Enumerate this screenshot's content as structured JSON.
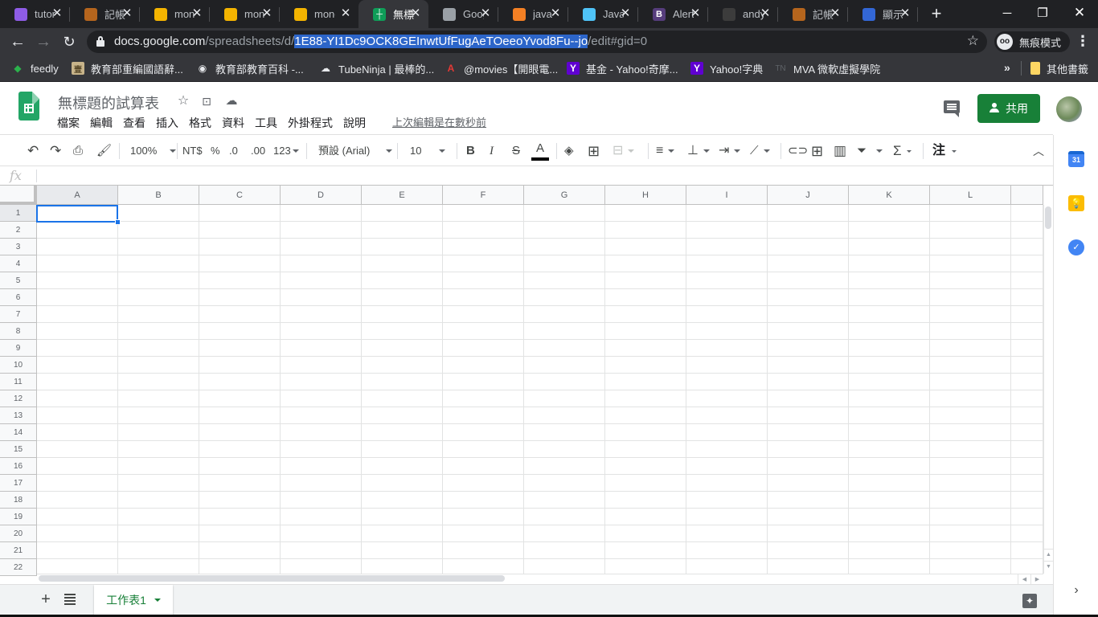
{
  "browser": {
    "tabs": [
      {
        "title": "tutorial",
        "icon": "stack-icon",
        "color": "#8e5ce6"
      },
      {
        "title": "記帳",
        "icon": "book-icon",
        "color": "#b5651d"
      },
      {
        "title": "money",
        "icon": "apps-script-icon",
        "color": "#f4b400"
      },
      {
        "title": "money",
        "icon": "apps-script-icon",
        "color": "#f4b400"
      },
      {
        "title": "money",
        "icon": "apps-script-icon",
        "color": "#f4b400"
      },
      {
        "title": "無標題的試算表",
        "icon": "sheets-icon",
        "color": "#0f9d58",
        "active": true
      },
      {
        "title": "Google",
        "icon": "circle-icon",
        "color": "#9aa0a6"
      },
      {
        "title": "java",
        "icon": "stackoverflow-icon",
        "color": "#f48024"
      },
      {
        "title": "Java",
        "icon": "globe-icon",
        "color": "#4fc3f7"
      },
      {
        "title": "Alert",
        "icon": "bootstrap-icon",
        "color": "#563d7c"
      },
      {
        "title": "andy",
        "icon": "github-icon",
        "color": "#3c3c3c"
      },
      {
        "title": "記帳",
        "icon": "book-icon",
        "color": "#b5651d"
      },
      {
        "title": "顯示",
        "icon": "chat-icon",
        "color": "#3367d6"
      }
    ],
    "new_tab": "+",
    "window_controls": {
      "minimize": "─",
      "restore": "❐",
      "close": "✕"
    },
    "url": {
      "host": "docs.google.com",
      "path_before": "/spreadsheets/d/",
      "selected": "1E88-YI1Dc9OCK8GEInwtUfFugAeTOeeoYvod8Fu--jo",
      "path_after": "/edit#gid=0"
    },
    "incognito_label": "無痕模式",
    "bookmarks": [
      {
        "label": "feedly",
        "icon": "feedly-icon",
        "color": "#2bb24c"
      },
      {
        "label": "教育部重編國語辭...",
        "icon": "dictionary-icon",
        "color": "#c8b48a"
      },
      {
        "label": "教育部教育百科 -...",
        "icon": "globe-icon",
        "color": "#e8eaed"
      },
      {
        "label": "TubeNinja | 最棒的...",
        "icon": "cloud-download-icon",
        "color": "#e8eaed"
      },
      {
        "label": "@movies【開眼電...",
        "icon": "atmovies-icon",
        "color": "#e53935"
      },
      {
        "label": "基金 - Yahoo!奇摩...",
        "icon": "yahoo-icon",
        "color": "#5f01d1"
      },
      {
        "label": "Yahoo!字典",
        "icon": "yahoo-icon",
        "color": "#5f01d1"
      },
      {
        "label": "MVA 微軟虛擬學院",
        "icon": "tn-icon",
        "color": "#5f6368"
      }
    ],
    "bookmarks_more": "»",
    "other_bookmarks": "其他書籤"
  },
  "doc": {
    "title": "無標題的試算表",
    "menu": [
      "檔案",
      "編輯",
      "查看",
      "插入",
      "格式",
      "資料",
      "工具",
      "外掛程式",
      "說明"
    ],
    "last_edit": "上次編輯是在數秒前",
    "share_label": "共用",
    "brand_color": "#188038"
  },
  "toolbar": {
    "zoom": "100%",
    "currency": "NT$",
    "percent": "%",
    "decrease_decimal": ".0",
    "increase_decimal": ".00",
    "more_formats": "123",
    "font": "預設 (Arial)",
    "font_size": "10",
    "bold": "B",
    "italic": "I",
    "strike": "S",
    "text_color": "A",
    "input_tools": "注"
  },
  "formula_bar": {
    "fx_label": "fx",
    "value": ""
  },
  "grid": {
    "columns": [
      "A",
      "B",
      "C",
      "D",
      "E",
      "F",
      "G",
      "H",
      "I",
      "J",
      "K",
      "L"
    ],
    "rows": [
      "1",
      "2",
      "3",
      "4",
      "5",
      "6",
      "7",
      "8",
      "9",
      "10",
      "11",
      "12",
      "13",
      "14",
      "15",
      "16",
      "17",
      "18",
      "19",
      "20",
      "21",
      "22"
    ],
    "active_cell": "A1",
    "selection_color": "#1a73e8"
  },
  "sheets": {
    "add_label": "+",
    "tabs": [
      {
        "label": "工作表1",
        "active": true
      }
    ]
  },
  "side_panel": {
    "calendar_day": "31"
  }
}
